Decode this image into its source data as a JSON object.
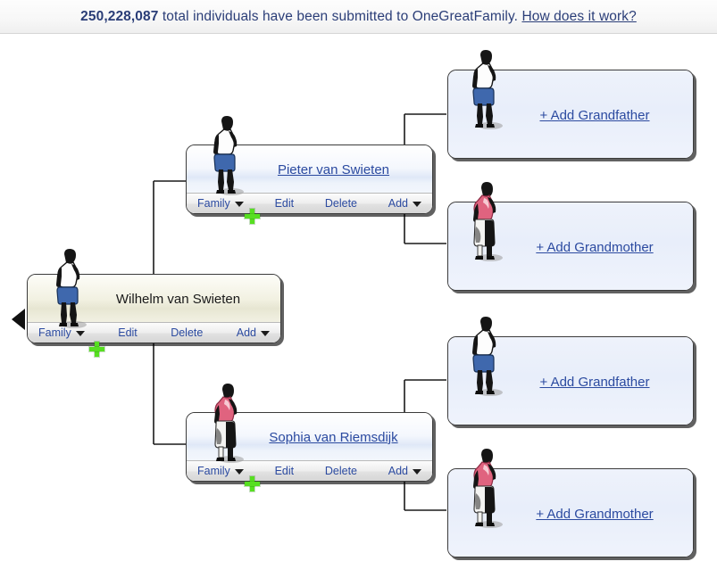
{
  "header": {
    "count": "250,228,087",
    "text_before": " total individuals have been submitted to OneGreatFamily. ",
    "link_label": "How does it work?",
    "count_color": "#2a3d77",
    "link_color": "#2b3e78"
  },
  "nav": {
    "back_arrow_name": "previous-generation-arrow"
  },
  "toolbar_labels": {
    "family": "Family",
    "edit": "Edit",
    "delete": "Delete",
    "add": "Add"
  },
  "cards": {
    "focus": {
      "name": "Wilhelm van Swieten",
      "gender": "male",
      "style": "cream",
      "has_toolbar": true,
      "is_link": false
    },
    "father": {
      "name": "Pieter van Swieten",
      "gender": "male",
      "style": "blue",
      "has_toolbar": true,
      "is_link": true
    },
    "mother": {
      "name": "Sophia van Riemsdijk",
      "gender": "female",
      "style": "blue",
      "has_toolbar": true,
      "is_link": true
    },
    "paternal_grandfather": {
      "name": "+ Add Grandfather",
      "gender": "male",
      "style": "empty",
      "has_toolbar": false,
      "is_link": true
    },
    "paternal_grandmother": {
      "name": "+ Add Grandmother",
      "gender": "female",
      "style": "empty",
      "has_toolbar": false,
      "is_link": true
    },
    "maternal_grandfather": {
      "name": "+ Add Grandfather",
      "gender": "male",
      "style": "empty",
      "has_toolbar": false,
      "is_link": true
    },
    "maternal_grandmother": {
      "name": "+ Add Grandmother",
      "gender": "female",
      "style": "empty",
      "has_toolbar": false,
      "is_link": true
    }
  },
  "colors": {
    "link": "#2b4aa0",
    "card_border": "#3b3b3b",
    "plus_badge": "#57df21",
    "connector": "#1a1a1a"
  }
}
